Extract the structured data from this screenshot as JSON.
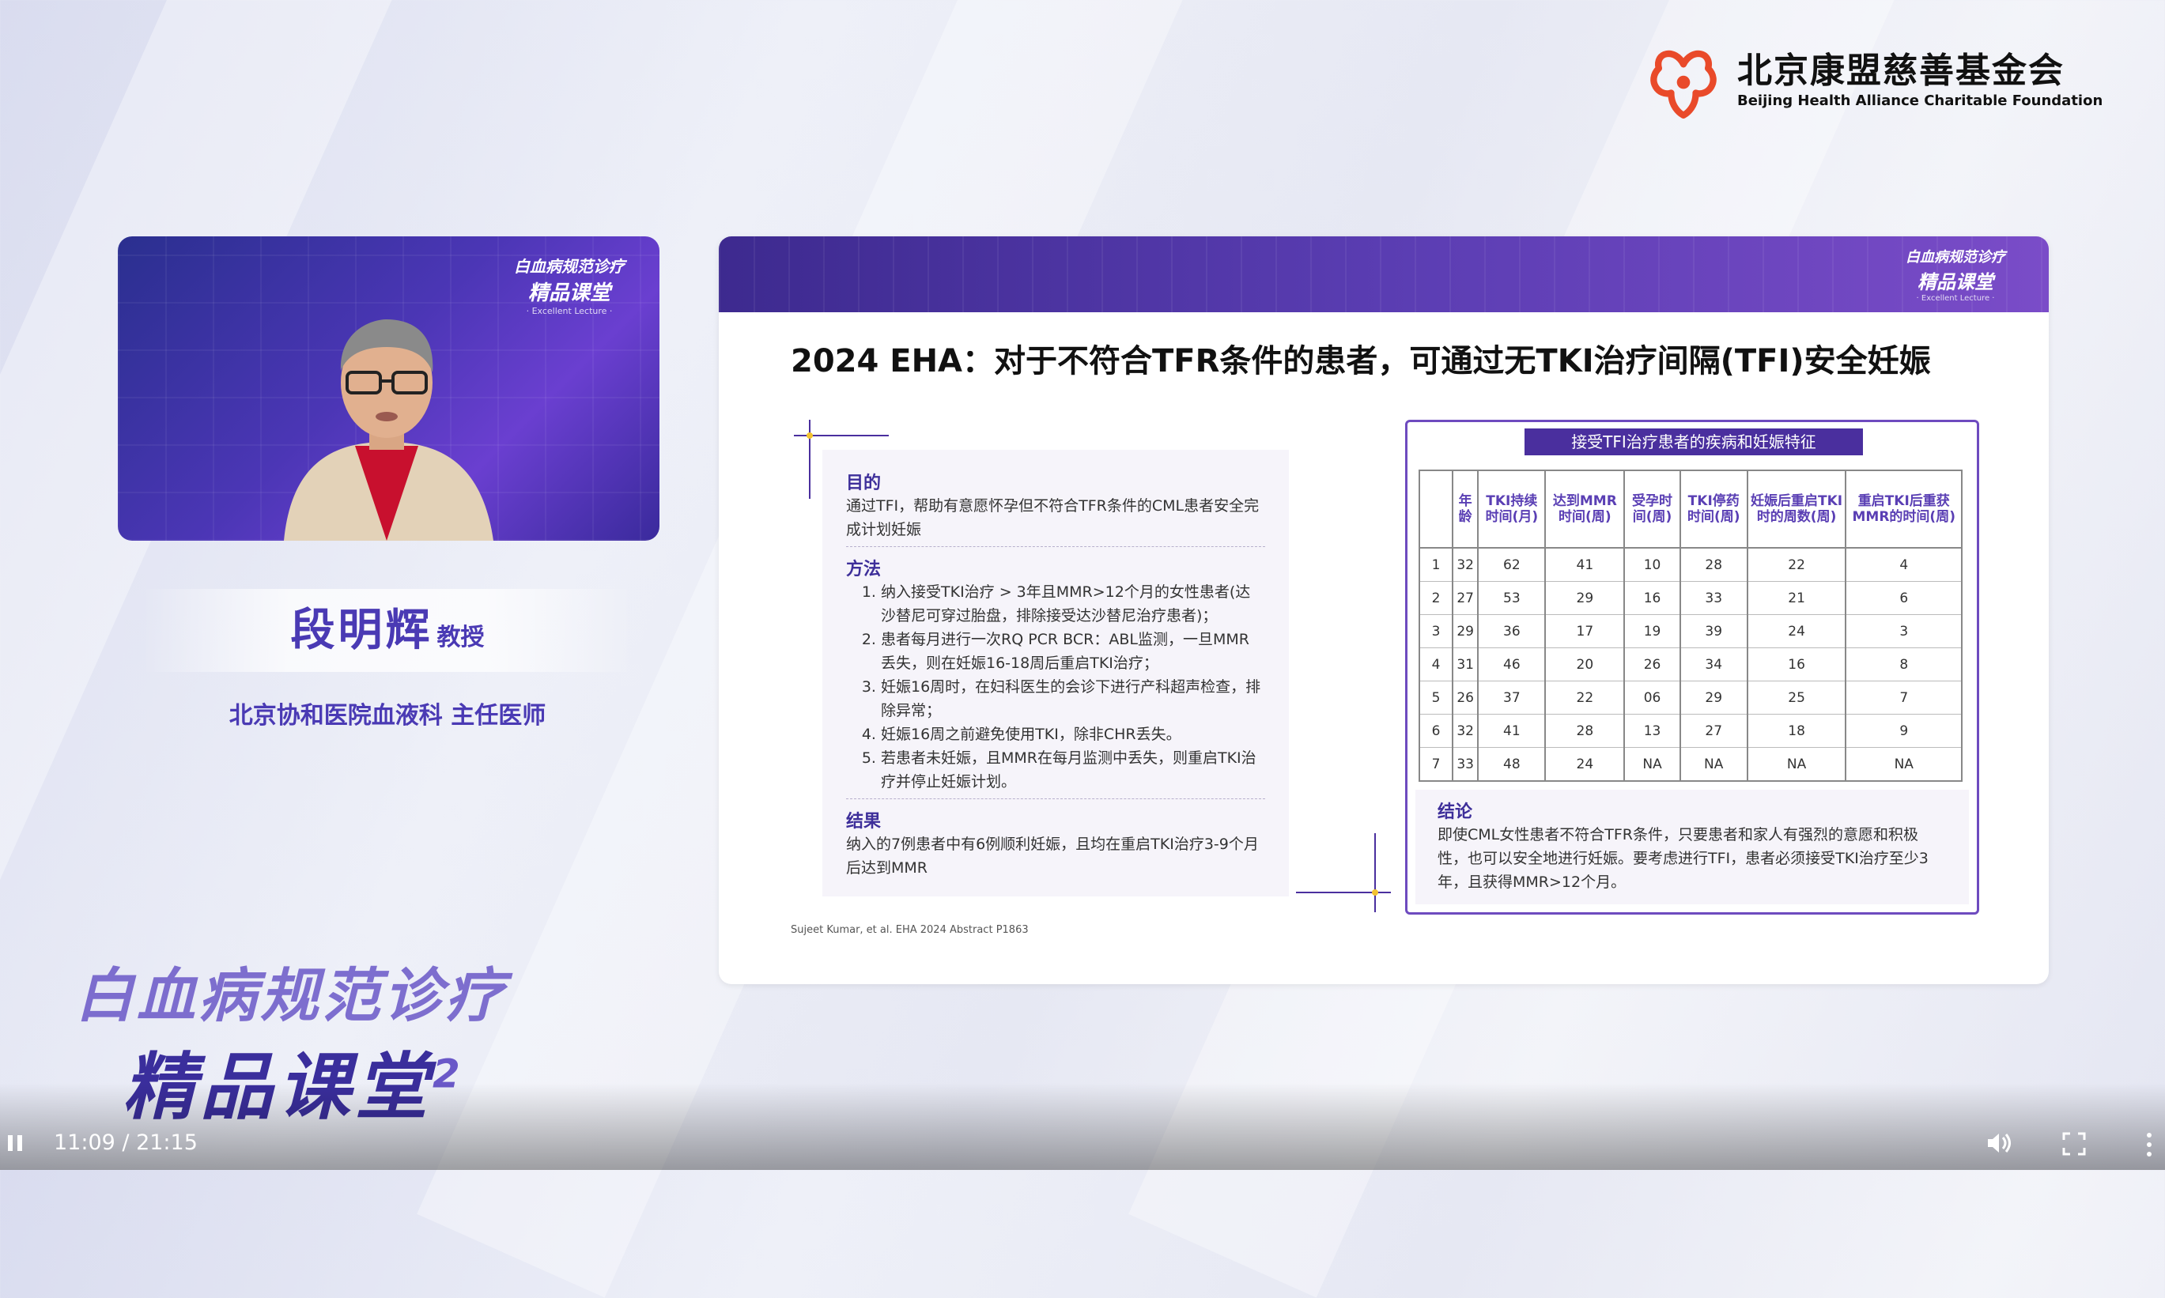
{
  "logo": {
    "cn": "北京康盟慈善基金会",
    "en": "Beijing Health Alliance Charitable Foundation"
  },
  "video_logo": {
    "line1": "白血病规范诊疗",
    "line2": "精品课堂",
    "line3": "· Excellent Lecture ·"
  },
  "speaker": {
    "name": "段明辉",
    "title": "教授",
    "affiliation": "北京协和医院血液科   主任医师"
  },
  "brand": {
    "line1": "白血病规范诊疗",
    "line2": "精品课堂",
    "mark": "2"
  },
  "slide": {
    "title": "2024 EHA：对于不符合TFR条件的患者，可通过无TKI治疗间隔(TFI)安全妊娠",
    "purpose_head": "目的",
    "purpose_text": "通过TFI，帮助有意愿怀孕但不符合TFR条件的CML患者安全完成计划妊娠",
    "method_head": "方法",
    "methods": [
      "纳入接受TKI治疗 > 3年且MMR>12个月的女性患者(达沙替尼可穿过胎盘，排除接受达沙替尼治疗患者)；",
      "患者每月进行一次RQ PCR BCR：ABL监测，一旦MMR 丢失，则在妊娠16-18周后重启TKI治疗；",
      "妊娠16周时，在妇科医生的会诊下进行产科超声检查，排除异常；",
      "妊娠16周之前避免使用TKI，除非CHR丢失。",
      "若患者未妊娠，且MMR在每月监测中丢失，则重启TKI治疗并停止妊娠计划。"
    ],
    "result_head": "结果",
    "result_text": "纳入的7例患者中有6例顺利妊娠，且均在重启TKI治疗3-9个月后达到MMR",
    "citation": "Sujeet Kumar, et al. EHA 2024 Abstract P1863",
    "table_title": "接受TFI治疗患者的疾病和妊娠特征",
    "table_headers": [
      "",
      "年龄",
      "TKI持续时间(月)",
      "达到MMR时间(周)",
      "受孕时间(周)",
      "TKI停药时间(周)",
      "妊娠后重启TKI时的周数(周)",
      "重启TKI后重获MMR的时间(周)"
    ],
    "table_rows": [
      [
        "1",
        "32",
        "62",
        "41",
        "10",
        "28",
        "22",
        "4"
      ],
      [
        "2",
        "27",
        "53",
        "29",
        "16",
        "33",
        "21",
        "6"
      ],
      [
        "3",
        "29",
        "36",
        "17",
        "19",
        "39",
        "24",
        "3"
      ],
      [
        "4",
        "31",
        "46",
        "20",
        "26",
        "34",
        "16",
        "8"
      ],
      [
        "5",
        "26",
        "37",
        "22",
        "06",
        "29",
        "25",
        "7"
      ],
      [
        "6",
        "32",
        "41",
        "28",
        "13",
        "27",
        "18",
        "9"
      ],
      [
        "7",
        "33",
        "48",
        "24",
        "NA",
        "NA",
        "NA",
        "NA"
      ]
    ],
    "conclusion_head": "结论",
    "conclusion_text": "即使CML女性患者不符合TFR条件，只要患者和家人有强烈的意愿和积极性，也可以安全地进行妊娠。要考虑进行TFI，患者必须接受TKI治疗至少3年，且获得MMR>12个月。"
  },
  "player": {
    "time": "11:09 / 21:15",
    "state": "playing"
  }
}
